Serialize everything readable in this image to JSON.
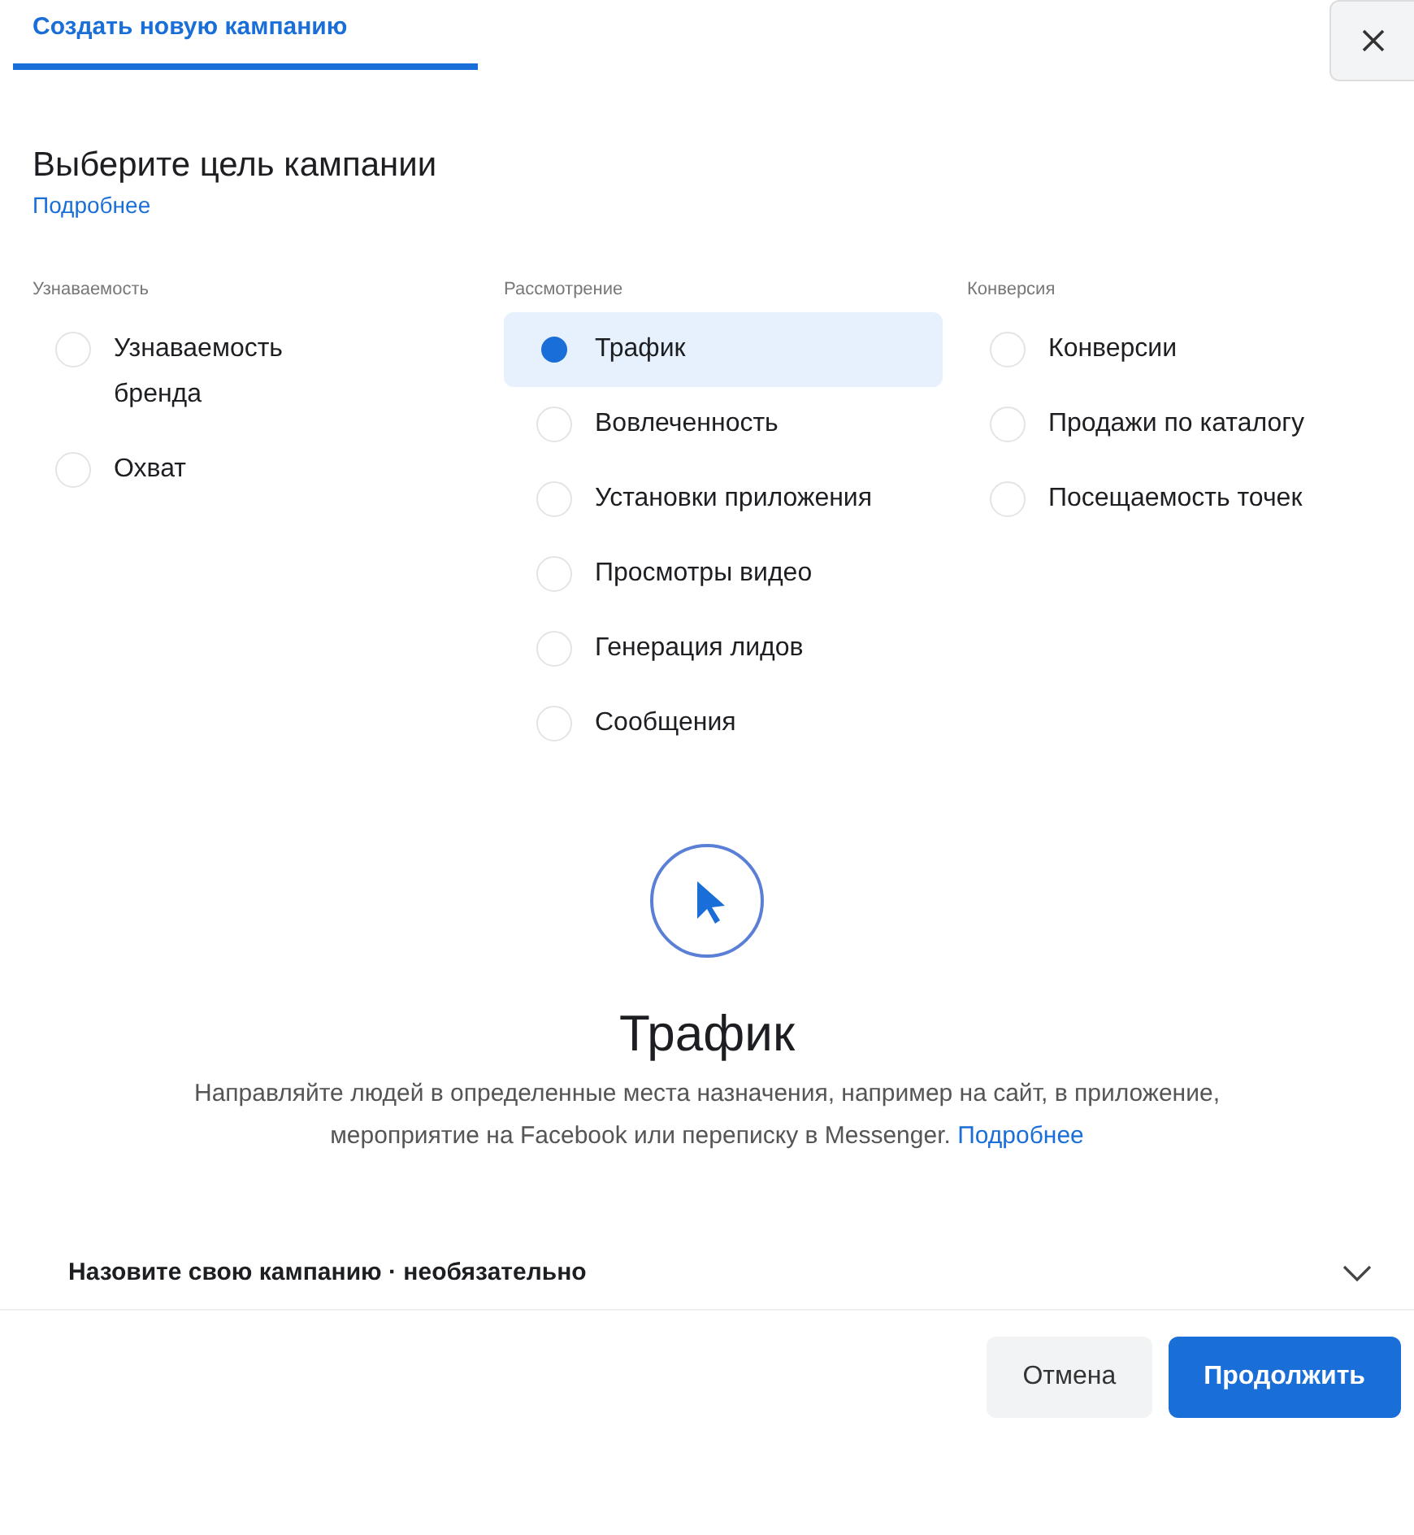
{
  "tab": {
    "label": "Создать новую кампанию",
    "selected": true
  },
  "heading": "Выберите цель кампании",
  "heading_link": "Подробнее",
  "columns": [
    {
      "title": "Узнаваемость",
      "options": [
        {
          "label": "Узнаваемость бренда",
          "selected": false
        },
        {
          "label": "Охват",
          "selected": false
        }
      ]
    },
    {
      "title": "Рассмотрение",
      "options": [
        {
          "label": "Трафик",
          "selected": true
        },
        {
          "label": "Вовлеченность",
          "selected": false
        },
        {
          "label": "Установки приложения",
          "selected": false
        },
        {
          "label": "Просмотры видео",
          "selected": false
        },
        {
          "label": "Генерация лидов",
          "selected": false
        },
        {
          "label": "Сообщения",
          "selected": false
        }
      ]
    },
    {
      "title": "Конверсия",
      "options": [
        {
          "label": "Конверсии",
          "selected": false
        },
        {
          "label": "Продажи по каталогу",
          "selected": false
        },
        {
          "label": "Посещаемость точек",
          "selected": false
        }
      ]
    }
  ],
  "detail": {
    "title": "Трафик",
    "description": "Направляйте людей в определенные места назначения, например на сайт, в приложение, мероприятие на Facebook или переписку в Messenger.",
    "link": "Подробнее"
  },
  "name_section": {
    "label": "Назовите свою кампанию · необязательно",
    "expanded": false
  },
  "buttons": {
    "cancel": "Отмена",
    "continue": "Продолжить"
  }
}
